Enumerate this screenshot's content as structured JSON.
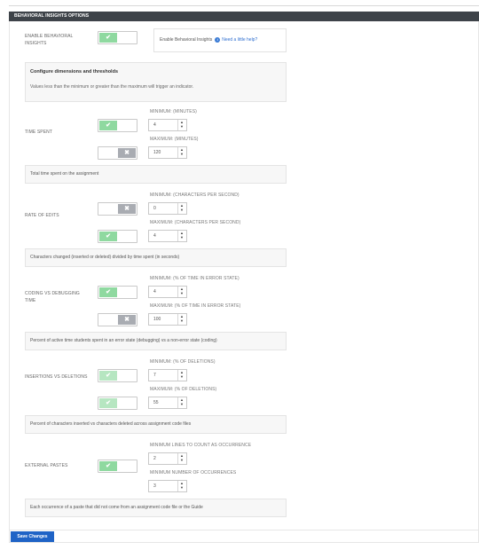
{
  "header": {
    "title": "BEHAVIORAL INSIGHTS OPTIONS"
  },
  "enable": {
    "label": "ENABLE BEHAVIORAL INSIGHTS",
    "toggle_on": true,
    "info_text": "Enable Behavioral Insights",
    "help_link": "Need a little help?"
  },
  "config": {
    "title": "Configure dimensions and thresholds",
    "subtitle": "Values less than the minimum or greater than the maximum will trigger an indicator."
  },
  "metrics": [
    {
      "label": "TIME SPENT",
      "min_label": "MINIMUM: (MINUTES)",
      "min_value": "4",
      "min_enabled": true,
      "max_label": "MAXIMUM: (MINUTES)",
      "max_value": "120",
      "max_enabled": false,
      "description": "Total time spent on the assignment"
    },
    {
      "label": "RATE OF EDITS",
      "min_label": "MINIMUM: (CHARACTERS PER SECOND)",
      "min_value": "0",
      "min_enabled": false,
      "max_label": "MAXIMUM: (CHARACTERS PER SECOND)",
      "max_value": "4",
      "max_enabled": true,
      "description": "Characters changed (inserted or deleted) divided by time spent (in seconds)"
    },
    {
      "label": "CODING VS DEBUGGING TIME",
      "min_label": "MINIMUM: (% OF TIME IN ERROR STATE)",
      "min_value": "4",
      "min_enabled": true,
      "max_label": "MAXIMUM: (% OF TIME IN ERROR STATE)",
      "max_value": "100",
      "max_enabled": false,
      "description": "Percent of active time students spent in an error state (debugging) vs a non-error state (coding)"
    },
    {
      "label": "INSERTIONS VS DELETIONS",
      "min_label": "MINIMUM: (% OF DELETIONS)",
      "min_value": "7",
      "min_enabled": true,
      "max_label": "MAXIMUM: (% OF DELETIONS)",
      "max_value": "55",
      "max_enabled": true,
      "description": "Percent of characters inserted vs characters deleted across assignment code files"
    },
    {
      "label": "EXTERNAL PASTES",
      "min_label": "MINIMUM LINES TO COUNT AS OCCURRENCE",
      "min_value": "2",
      "min_enabled": true,
      "max_label": "MINIMUM NUMBER OF OCCURRENCES",
      "max_value": "3",
      "description": "Each occurrence of a paste that did not come from an assignment code file or the Guide"
    }
  ],
  "icons": {
    "on_glyph": "✔",
    "off_glyph": "✖",
    "up_glyph": "▲",
    "down_glyph": "▼",
    "help_glyph": "i"
  },
  "footer": {
    "save_label": "Save Changes"
  },
  "colors": {
    "header_bg": "#3e4349",
    "toggle_on": "#8fd9a0",
    "toggle_off": "#a9acb2",
    "save_bg": "#1f63c6",
    "link": "#2f6fd0"
  }
}
